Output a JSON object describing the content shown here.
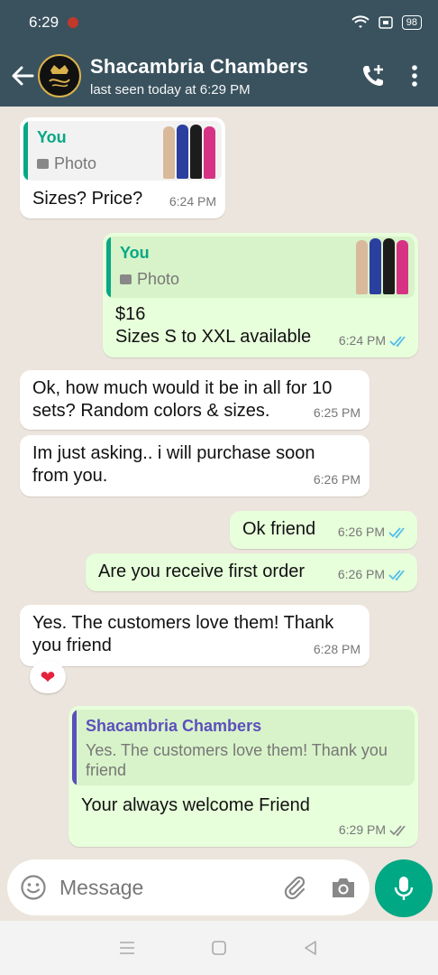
{
  "status_bar": {
    "time": "6:29",
    "battery": "98"
  },
  "header": {
    "contact_name": "Shacambria Chambers",
    "contact_status": "last seen today at 6:29 PM"
  },
  "messages": [
    {
      "dir": "in",
      "quote_author": "You",
      "quote_text": "Photo",
      "text": "Sizes? Price?",
      "time": "6:24 PM"
    },
    {
      "dir": "out",
      "quote_author": "You",
      "quote_text": "Photo",
      "text_line1": "$16",
      "text_line2": "Sizes S to XXL available",
      "time": "6:24 PM"
    },
    {
      "dir": "in",
      "text_line1": "Ok, how much would it be in all for 10",
      "text_line2": "sets? Random colors & sizes.",
      "time": "6:25 PM"
    },
    {
      "dir": "in",
      "text_line1": "Im just asking.. i will purchase soon",
      "text_line2": "from you.",
      "time": "6:26 PM"
    },
    {
      "dir": "out",
      "text": "Ok friend",
      "time": "6:26 PM"
    },
    {
      "dir": "out",
      "text": "Are you receive first order",
      "time": "6:26 PM"
    },
    {
      "dir": "in",
      "text_line1": "Yes. The customers love them! Thank",
      "text_line2": "you friend",
      "time": "6:28 PM",
      "reaction": "❤"
    },
    {
      "dir": "out",
      "quote_author": "Shacambria Chambers",
      "quote_line1": "Yes. The customers love them! Thank you",
      "quote_line2": "friend",
      "text": "Your always welcome Friend",
      "time": "6:29 PM"
    }
  ],
  "input": {
    "placeholder": "Message"
  },
  "colors": {
    "header": "#3a525e",
    "chat_bg": "#ece5dd",
    "outgoing": "#e7ffdb",
    "incoming": "#ffffff",
    "accent": "#00a884",
    "read_ticks": "#53bdeb",
    "quote_author_you": "#06a884",
    "quote_author_contact": "#5b4fbd"
  },
  "icons": [
    "back-arrow-icon",
    "add-call-icon",
    "more-options-icon",
    "emoji-icon",
    "attach-icon",
    "camera-icon",
    "mic-icon",
    "photo-icon",
    "double-tick-icon",
    "heart-icon",
    "nav-menu-icon",
    "nav-home-icon",
    "nav-back-icon"
  ]
}
